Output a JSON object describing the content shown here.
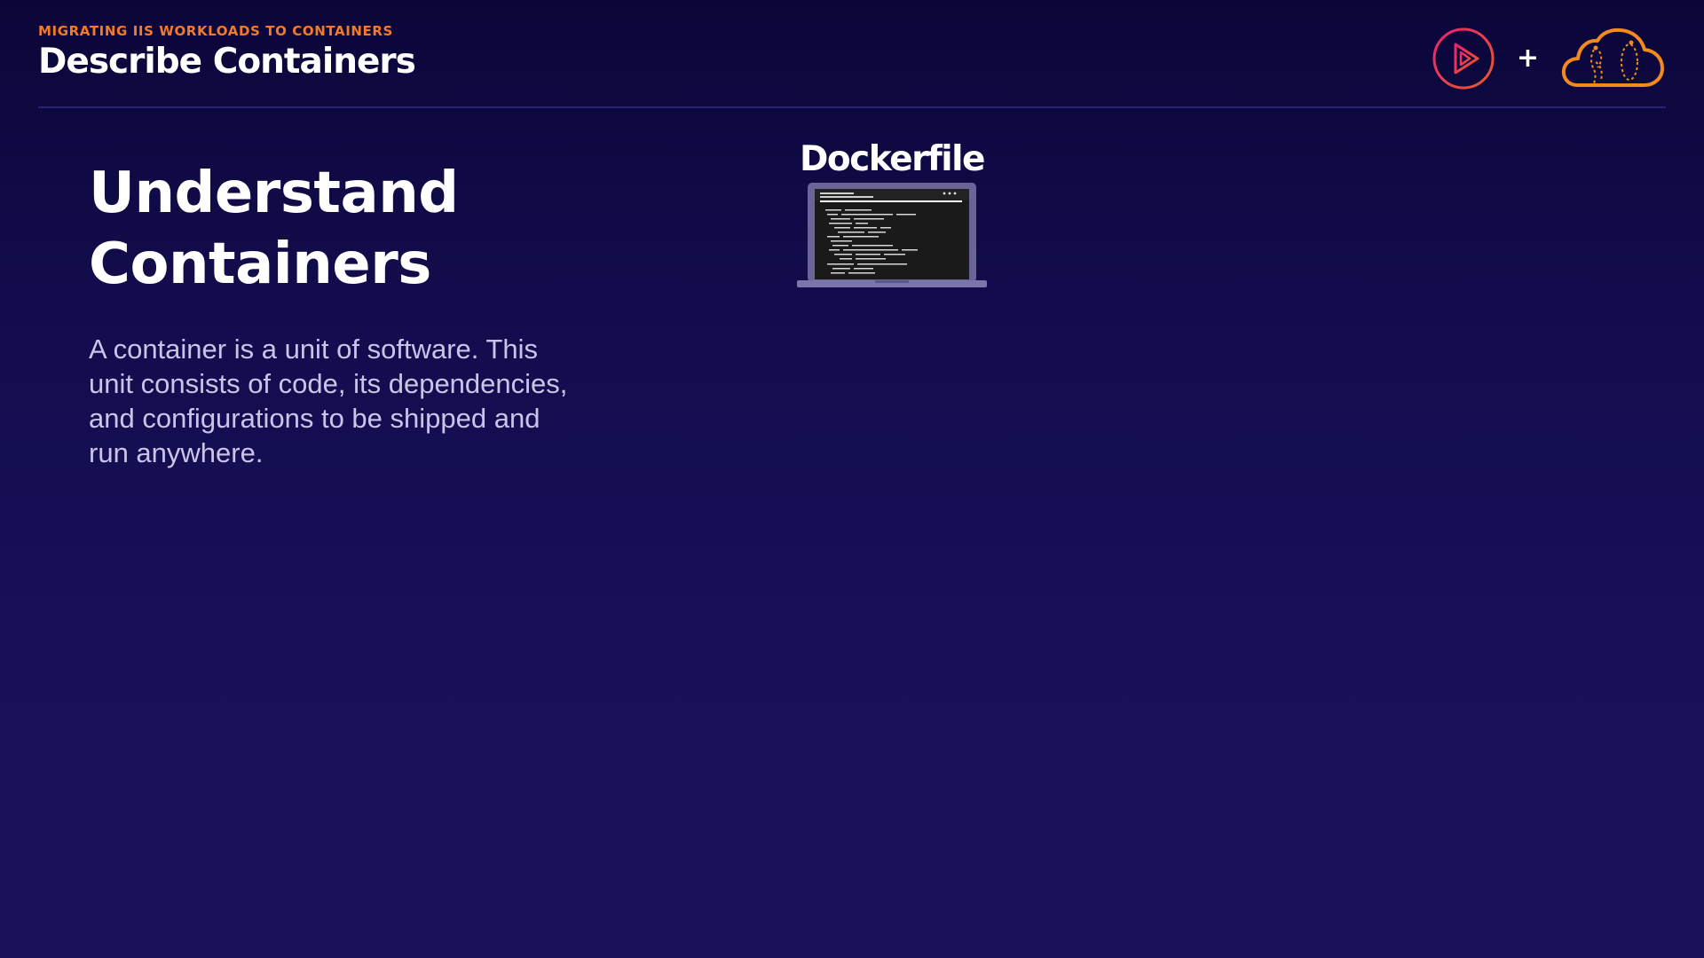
{
  "header": {
    "course_title": "MIGRATING IIS WORKLOADS TO CONTAINERS",
    "module_title": "Describe Containers",
    "logos": {
      "left": "pluralsight-play-logo",
      "separator": "+",
      "right": "cloud-logo"
    }
  },
  "slide": {
    "heading": "Understand Containers",
    "body": "A container is a unit of software. This unit consists of code, its dependencies, and configurations to be shipped and run anywhere."
  },
  "illustration": {
    "label": "Dockerfile",
    "icon": "laptop-terminal-icon"
  },
  "colors": {
    "accent_orange": "#f47a2a",
    "accent_pink": "#e8265b",
    "background_top": "#0b0638",
    "background_bottom": "#191159",
    "body_text": "#c9c5e8"
  }
}
